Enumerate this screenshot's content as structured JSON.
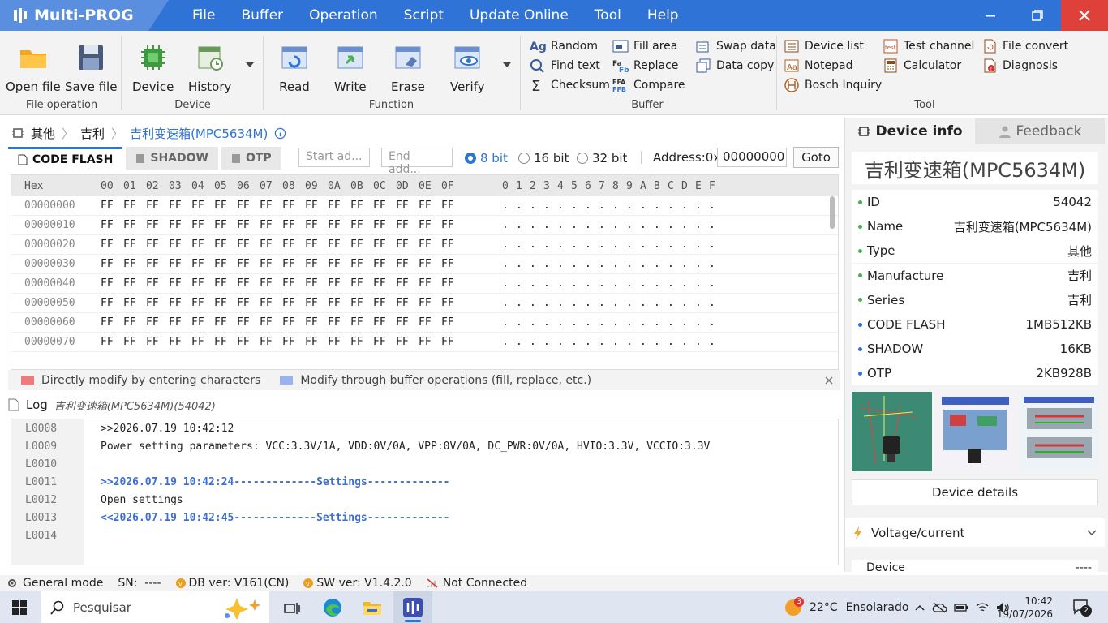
{
  "app": {
    "title": "Multi-PROG"
  },
  "menu": [
    "File",
    "Buffer",
    "Operation",
    "Script",
    "Update Online",
    "Tool",
    "Help"
  ],
  "ribbon": {
    "file": {
      "open": "Open file",
      "save": "Save file",
      "group": "File operation"
    },
    "device": {
      "device": "Device",
      "history": "History",
      "group": "Device"
    },
    "function": {
      "read": "Read",
      "write": "Write",
      "erase": "Erase",
      "verify": "Verify",
      "group": "Function"
    },
    "buffer": {
      "random": "Random",
      "find": "Find text",
      "checksum": "Checksum",
      "fill": "Fill area",
      "replace": "Replace",
      "compare": "Compare",
      "swap": "Swap data",
      "copy": "Data copy",
      "group": "Buffer"
    },
    "tool": {
      "devlist": "Device list",
      "notepad": "Notepad",
      "bosch": "Bosch Inquiry",
      "test": "Test channel",
      "calc": "Calculator",
      "convert": "File convert",
      "diag": "Diagnosis",
      "group": "Tool"
    }
  },
  "breadcrumb": {
    "c1": "其他",
    "c2": "吉利",
    "c3": "吉利变速箱(MPC5634M)"
  },
  "tabs": {
    "t1": "CODE FLASH",
    "t2": "SHADOW",
    "t3": "OTP"
  },
  "addrbar": {
    "start_ph": "Start ad...",
    "end_ph": "End add...",
    "r8": "8 bit",
    "r16": "16 bit",
    "r32": "32 bit",
    "addr_label": "Address:0x",
    "addr_value": "00000000",
    "goto": "Goto"
  },
  "hex": {
    "header_label": "Hex",
    "cols": [
      "00",
      "01",
      "02",
      "03",
      "04",
      "05",
      "06",
      "07",
      "08",
      "09",
      "0A",
      "0B",
      "0C",
      "0D",
      "0E",
      "0F"
    ],
    "ascii_cols": [
      "0",
      "1",
      "2",
      "3",
      "4",
      "5",
      "6",
      "7",
      "8",
      "9",
      "A",
      "B",
      "C",
      "D",
      "E",
      "F"
    ],
    "rows": [
      "00000000",
      "00000010",
      "00000020",
      "00000030",
      "00000040",
      "00000050",
      "00000060",
      "00000070"
    ],
    "byte": "FF",
    "ascii_char": "."
  },
  "legend": {
    "red": "Directly modify by entering characters",
    "blue": "Modify through buffer operations (fill, replace, etc.)"
  },
  "log": {
    "title": "Log",
    "subtitle": "吉利变速箱(MPC5634M)(54042)",
    "lines": [
      {
        "no": "L0008",
        "text": ">>2026.07.19 10:42:12"
      },
      {
        "no": "L0009",
        "text": "Power setting parameters: VCC:3.3V/1A, VDD:0V/0A, VPP:0V/0A, DC_PWR:0V/0A, HVIO:3.3V, VCCIO:3.3V"
      },
      {
        "no": "L0010",
        "text": ""
      },
      {
        "no": "L0011",
        "text": ">>2026.07.19 10:42:24-------------Settings-------------"
      },
      {
        "no": "L0012",
        "text": "Open settings"
      },
      {
        "no": "L0013",
        "text": "<<2026.07.19 10:42:45-------------Settings-------------"
      },
      {
        "no": "L0014",
        "text": ""
      }
    ]
  },
  "panel": {
    "tab_info": "Device info",
    "tab_feedback": "Feedback",
    "title": "吉利变速箱(MPC5634M)",
    "props": [
      {
        "k": "ID",
        "v": "54042"
      },
      {
        "k": "Name",
        "v": "吉利变速箱(MPC5634M)"
      },
      {
        "k": "Type",
        "v": "其他"
      },
      {
        "k": "Manufacture",
        "v": "吉利"
      },
      {
        "k": "Series",
        "v": "吉利"
      },
      {
        "k": "CODE FLASH",
        "v": "1MB512KB"
      },
      {
        "k": "SHADOW",
        "v": "16KB"
      },
      {
        "k": "OTP",
        "v": "2KB928B"
      }
    ],
    "details": "Device details",
    "voltage": "Voltage/current",
    "device_label": "Device",
    "device_value": "----"
  },
  "status": {
    "mode": "General mode",
    "sn": "SN:  ----",
    "db": "DB ver: V161(CN)",
    "sw": "SW ver: V1.4.2.0",
    "conn": "Not Connected"
  },
  "taskbar": {
    "search": "Pesquisar",
    "weather_temp": "22°C",
    "weather_desc": "Ensolarado",
    "weather_badge": "3",
    "time": "10:42",
    "date": "19/07/2026",
    "notif": "2"
  },
  "colors": {
    "accent": "#2f73d6",
    "log_blue": "#3e6fd0",
    "dot_green": "#4caf50",
    "dot_blue": "#2f73d6"
  }
}
